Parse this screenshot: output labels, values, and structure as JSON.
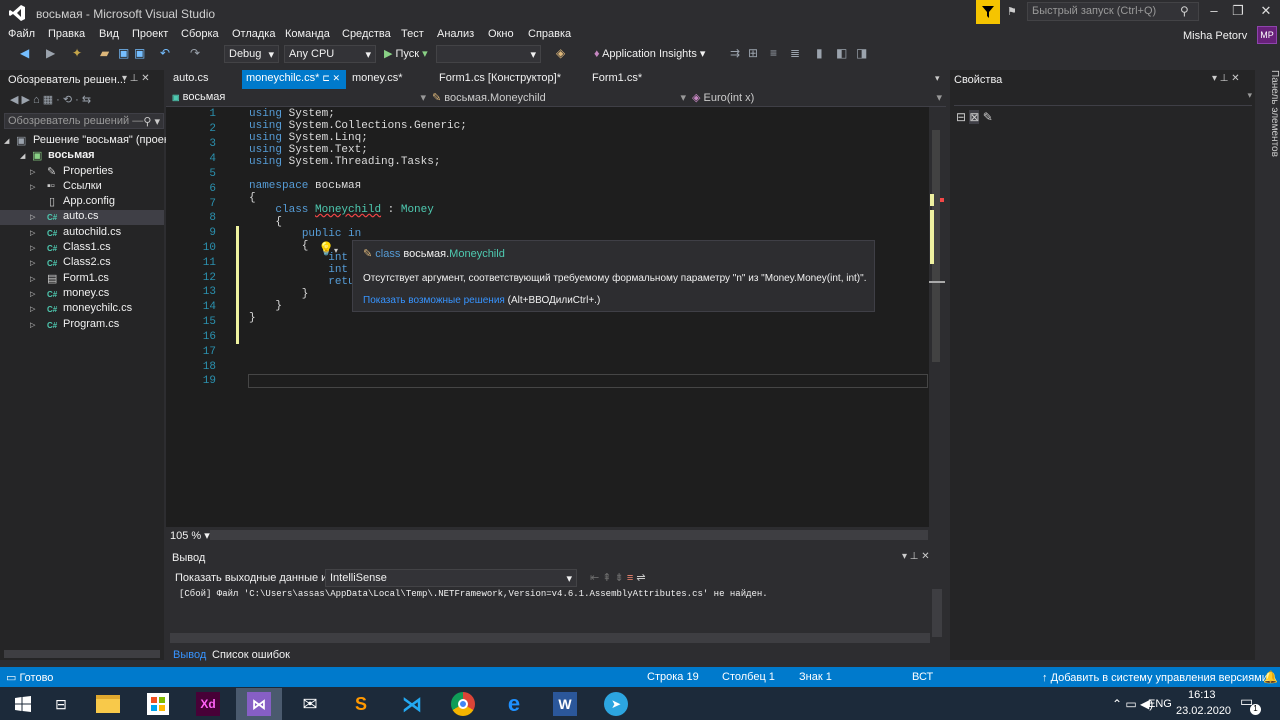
{
  "window": {
    "title": "восьмая - Microsoft Visual Studio",
    "quick_launch_placeholder": "Быстрый запуск (Ctrl+Q)",
    "user": "Misha Petorv",
    "avatar": "MP"
  },
  "menu": [
    "Файл",
    "Правка",
    "Вид",
    "Проект",
    "Сборка",
    "Отладка",
    "Команда",
    "Средства",
    "Тест",
    "Анализ",
    "Окно",
    "Справка"
  ],
  "toolbar": {
    "config": "Debug",
    "platform": "Any CPU",
    "run": "Пуск",
    "insights": "Application Insights"
  },
  "solution_explorer": {
    "title": "Обозреватель решен...",
    "search_placeholder": "Обозреватель решений —",
    "solution": "Решение \"восьмая\" (проек",
    "project": "восьмая",
    "items": [
      "Properties",
      "Ссылки",
      "App.config",
      "auto.cs",
      "autochild.cs",
      "Class1.cs",
      "Class2.cs",
      "Form1.cs",
      "money.cs",
      "moneychilc.cs",
      "Program.cs"
    ]
  },
  "tabs": [
    "auto.cs",
    "moneychilc.cs*",
    "money.cs*",
    "Form1.cs [Конструктор]*",
    "Form1.cs*"
  ],
  "navbar": {
    "project": "восьмая",
    "class": "восьмая.Moneychild",
    "member": "Euro(int x)"
  },
  "editor": {
    "zoom": "105 %",
    "line_numbers": [
      "1",
      "2",
      "3",
      "4",
      "5",
      "6",
      "7",
      "8",
      "9",
      "10",
      "11",
      "12",
      "13",
      "14",
      "15",
      "16",
      "17",
      "18",
      "19"
    ]
  },
  "tooltip": {
    "kind": "class",
    "ns": "восьмая.",
    "name": "Moneychild",
    "message": "Отсутствует аргумент, соответствующий требуемому формальному параметру \"n\" из \"Money.Money(int, int)\".",
    "link": "Показать возможные решения",
    "shortcut": "(Alt+ВВОДилиCtrl+.)"
  },
  "output": {
    "title": "Вывод",
    "source_label": "Показать выходные данные из:",
    "source": "IntelliSense",
    "line": "[Сбой] Файл 'C:\\Users\\assas\\AppData\\Local\\Temp\\.NETFramework,Version=v4.6.1.AssemblyAttributes.cs' не найден.",
    "tab_output": "Вывод",
    "tab_errors": "Список ошибок"
  },
  "properties": {
    "title": "Свойства",
    "side_panel": "Панель элементов"
  },
  "status": {
    "ready": "Готово",
    "line": "Строка 19",
    "col": "Столбец 1",
    "char": "Знак 1",
    "mode": "ВСТ",
    "vcs": "Добавить в систему управления версиями"
  },
  "taskbar": {
    "lang": "ENG",
    "time": "16:13",
    "date": "23.02.2020",
    "notif": "1"
  },
  "colors": {
    "accent": "#007acc",
    "keyword": "#569cd6",
    "type": "#4ec9b0",
    "linenum": "#2b91af"
  }
}
